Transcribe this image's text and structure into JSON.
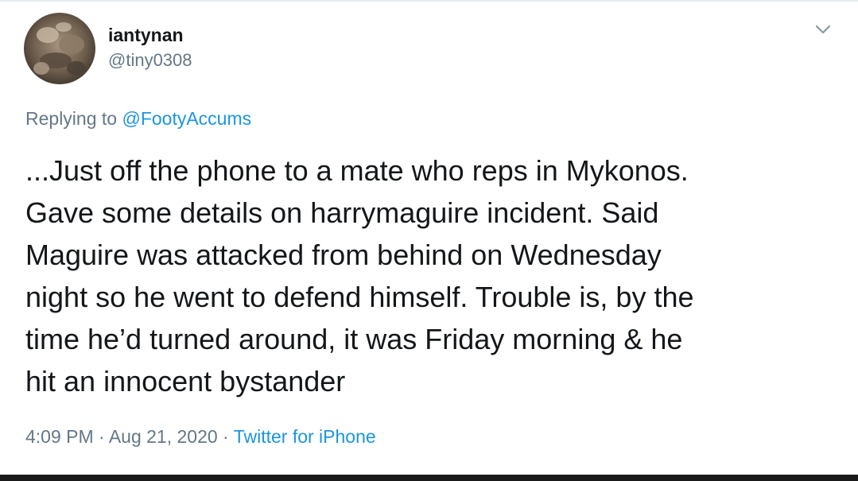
{
  "user": {
    "display_name": "iantynan",
    "handle": "@tiny0308"
  },
  "reply": {
    "prefix": "Replying to ",
    "mention": "@FootyAccums"
  },
  "tweet": {
    "lines": [
      "...Just off the phone to a mate who reps in Mykonos.",
      "Gave some details on harrymaguire incident. Said",
      "Maguire was attacked from behind on Wednesday",
      "night so he went to defend himself. Trouble is, by the",
      "time he’d turned around, it was Friday morning & he",
      "hit an innocent bystander"
    ]
  },
  "meta": {
    "time": "4:09 PM",
    "separator": " · ",
    "date": "Aug 21, 2020",
    "source": "Twitter for iPhone"
  },
  "icons": {
    "avatar": "avatar-photo",
    "menu": "chevron-down-icon"
  },
  "colors": {
    "text": "#14171a",
    "secondary": "#657786",
    "link": "#1b95e0"
  }
}
